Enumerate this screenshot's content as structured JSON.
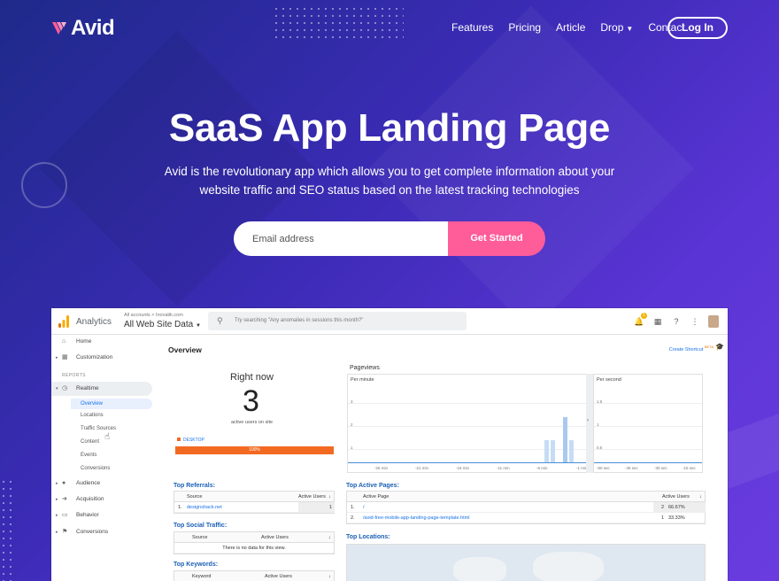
{
  "brand": {
    "name": "Avid",
    "accent": "#ff5c9a",
    "logo_color": "#ff5c9a"
  },
  "nav": {
    "items": [
      {
        "label": "Features"
      },
      {
        "label": "Pricing"
      },
      {
        "label": "Article"
      },
      {
        "label": "Drop",
        "has_dropdown": true
      },
      {
        "label": "Contact"
      }
    ],
    "login_label": "Log In"
  },
  "hero": {
    "title": "SaaS App Landing Page",
    "subtitle_line1": "Avid is the revolutionary app which allows you to get complete information about your",
    "subtitle_line2": "website traffic and SEO status based on the latest tracking technologies",
    "email_placeholder": "Email address",
    "cta_label": "Get Started"
  },
  "analytics": {
    "product": "Analytics",
    "breadcrumb": "All accounts > Inovatik.com",
    "view_name": "All Web Site Data",
    "search_placeholder": "Try searching \"Any anomalies in sessions this month?\"",
    "notification_count": "1",
    "sidebar": {
      "home": "Home",
      "customization": "Customization",
      "reports_header": "REPORTS",
      "realtime": "Realtime",
      "realtime_sub": [
        "Overview",
        "Locations",
        "Traffic Sources",
        "Content",
        "Events",
        "Conversions"
      ],
      "audience": "Audience",
      "acquisition": "Acquisition",
      "behavior": "Behavior",
      "conversions": "Conversions"
    },
    "overview": {
      "title": "Overview",
      "shortcut": "Create Shortcut",
      "shortcut_badge": "BETA",
      "right_now": "Right now",
      "active_count": "3",
      "active_label": "active users on site",
      "device_label": "DESKTOP",
      "device_pct": "100%",
      "pageviews_title": "Pageviews",
      "per_minute": "Per minute",
      "per_second": "Per second",
      "per_minute_yticks": [
        "3",
        "2",
        "1"
      ],
      "per_minute_xticks": [
        "-26 min",
        "-21 min",
        "-16 min",
        "-11 min",
        "-6 min",
        "-1 min"
      ],
      "per_second_yticks": [
        "1.5",
        "1",
        "0.5"
      ],
      "per_second_xticks": [
        "-60 sec",
        "-45 sec",
        "-30 sec",
        "-15 sec"
      ]
    },
    "referrals": {
      "title": "Top Referrals:",
      "headers": [
        "Source",
        "Active Users"
      ],
      "rows": [
        {
          "n": "1.",
          "source": "designshack.net",
          "users": "1"
        }
      ]
    },
    "social": {
      "title": "Top Social Traffic:",
      "headers": [
        "Source",
        "Active Users"
      ],
      "empty": "There is no data for this view."
    },
    "keywords": {
      "title": "Top Keywords:",
      "headers": [
        "Keyword",
        "Active Users"
      ]
    },
    "pages": {
      "title": "Top Active Pages:",
      "headers": [
        "Active Page",
        "Active Users"
      ],
      "rows": [
        {
          "n": "1.",
          "page": "/",
          "users": "2",
          "pct": "66.67%"
        },
        {
          "n": "2.",
          "page": "/avid-free-mobile-app-landing-page-template.html",
          "users": "1",
          "pct": "33.33%"
        }
      ]
    },
    "locations": {
      "title": "Top Locations:"
    }
  }
}
